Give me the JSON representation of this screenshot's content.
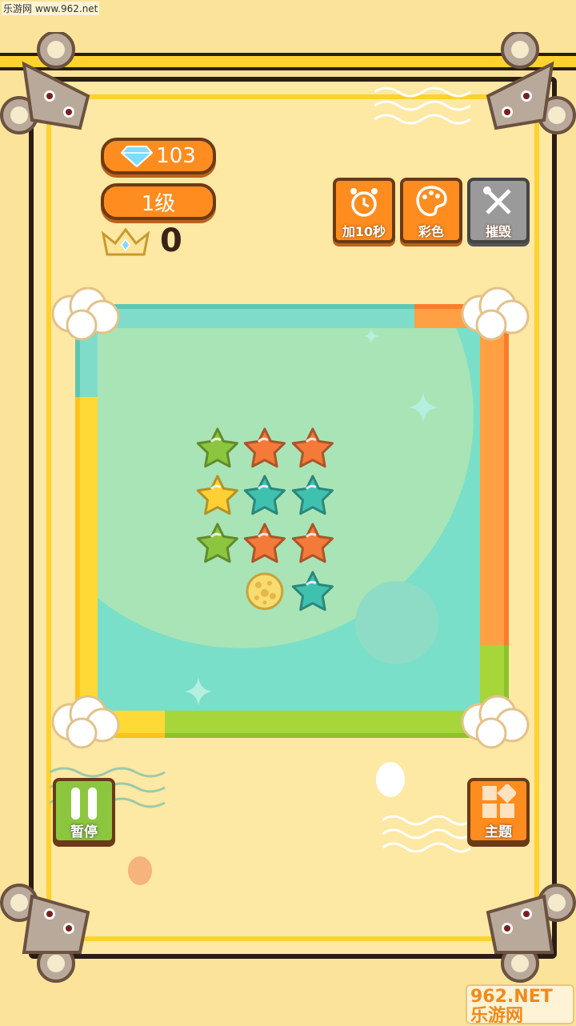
{
  "watermark": "乐游网 www.962.net",
  "hud": {
    "gems": "103",
    "level": "1级",
    "best_score": "0"
  },
  "tools": [
    {
      "label": "加10秒",
      "icon": "alarm-clock-icon"
    },
    {
      "label": "彩色",
      "icon": "palette-icon"
    },
    {
      "label": "摧毁",
      "icon": "wrench-screwdriver-icon"
    }
  ],
  "controls": {
    "pause_label": "暂停",
    "theme_label": "主题"
  },
  "board": {
    "grid": [
      [
        "empty",
        "empty",
        "empty",
        "empty",
        "empty",
        "empty",
        "empty",
        "empty"
      ],
      [
        "empty",
        "empty",
        "empty",
        "empty",
        "empty",
        "empty",
        "empty",
        "empty"
      ],
      [
        "empty",
        "empty",
        "green",
        "orange",
        "orange",
        "empty",
        "empty",
        "empty"
      ],
      [
        "empty",
        "empty",
        "yellow",
        "teal",
        "teal",
        "empty",
        "empty",
        "empty"
      ],
      [
        "empty",
        "empty",
        "green",
        "orange",
        "orange",
        "empty",
        "empty",
        "empty"
      ],
      [
        "empty",
        "empty",
        "empty",
        "cheese",
        "teal",
        "empty",
        "empty",
        "empty"
      ],
      [
        "empty",
        "empty",
        "empty",
        "empty",
        "empty",
        "empty",
        "empty",
        "empty"
      ],
      [
        "empty",
        "empty",
        "empty",
        "empty",
        "empty",
        "empty",
        "empty",
        "empty"
      ]
    ]
  },
  "colors": {
    "green": "#8cc63f",
    "orange": "#f47a3a",
    "yellow": "#ffd035",
    "teal": "#3fc1b0",
    "cheese": "#f7dc6f",
    "accent": "#ff8c1e",
    "frame": "#ffd230"
  },
  "logo_text": "962.NET 乐游网"
}
